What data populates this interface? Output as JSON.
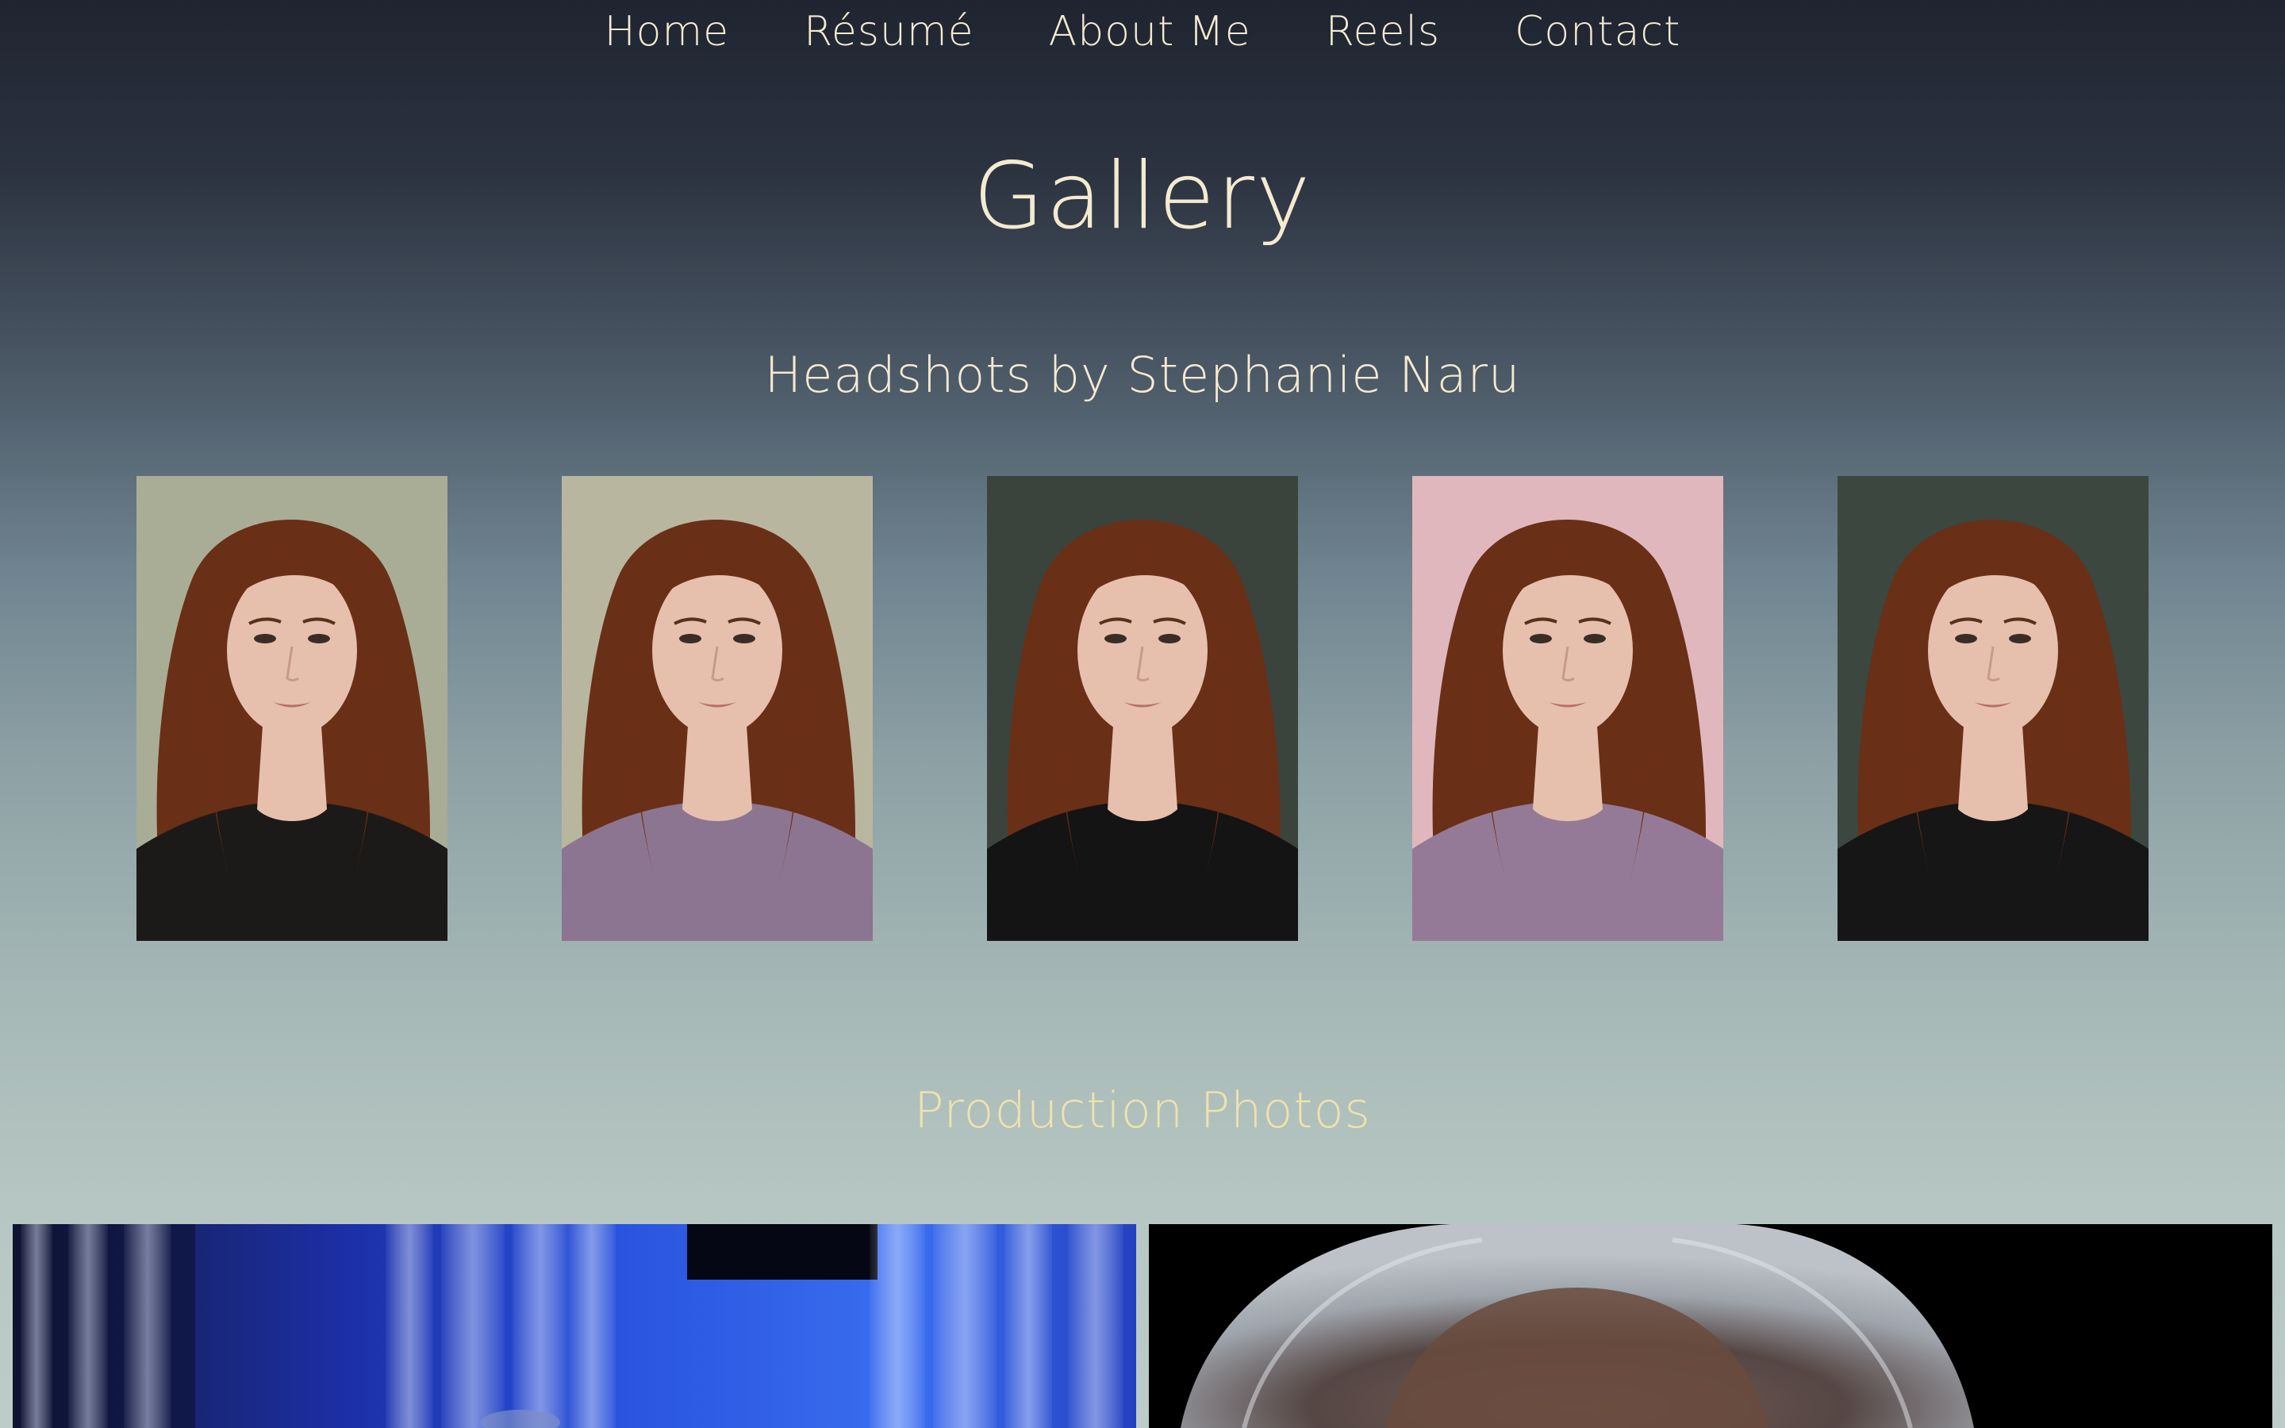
{
  "nav": {
    "items": [
      {
        "label": "Home"
      },
      {
        "label": "Résumé"
      },
      {
        "label": "About Me"
      },
      {
        "label": "Reels"
      },
      {
        "label": "Contact"
      }
    ]
  },
  "page": {
    "title": "Gallery"
  },
  "headshots": {
    "title": "Headshots by Stephanie Naru",
    "photos": [
      {
        "description": "headshot-photo",
        "backdrop": "#a9ad96",
        "top": "#1c1a18"
      },
      {
        "description": "headshot-photo",
        "backdrop": "#b9b6a0",
        "top": "#8c7590"
      },
      {
        "description": "headshot-photo",
        "backdrop": "#3b443c",
        "top": "#141414"
      },
      {
        "description": "headshot-photo",
        "backdrop": "#e0b7bd",
        "top": "#957a97"
      },
      {
        "description": "headshot-photo",
        "backdrop": "#3c473f",
        "top": "#161616"
      }
    ]
  },
  "production": {
    "title": "Production Photos"
  },
  "colors": {
    "text_cream": "#f4ead0",
    "production_title": "#efe2ad",
    "hair": "#6a2f17",
    "skin": "#e6c0ad"
  }
}
